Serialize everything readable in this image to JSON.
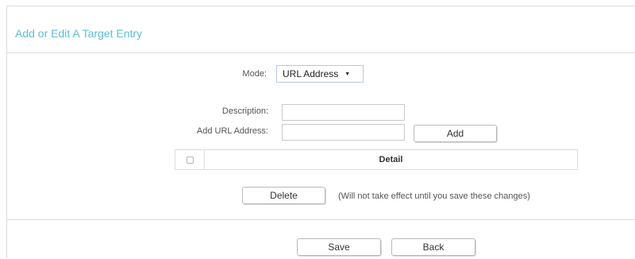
{
  "panel": {
    "title": "Add or Edit A Target Entry"
  },
  "form": {
    "mode": {
      "label": "Mode:",
      "selected": "URL Address",
      "caret_icon": "triangle-down-icon"
    },
    "description": {
      "label": "Description:",
      "value": ""
    },
    "url": {
      "label": "Add URL Address:",
      "value": "",
      "add_button": "Add"
    }
  },
  "table": {
    "header_detail": "Detail"
  },
  "actions": {
    "delete_button": "Delete",
    "delete_note": "(Will not take effect until you save these changes)",
    "save_button": "Save",
    "back_button": "Back"
  },
  "colors": {
    "title_accent": "#5bbfd4",
    "border": "#dcdcdc"
  }
}
